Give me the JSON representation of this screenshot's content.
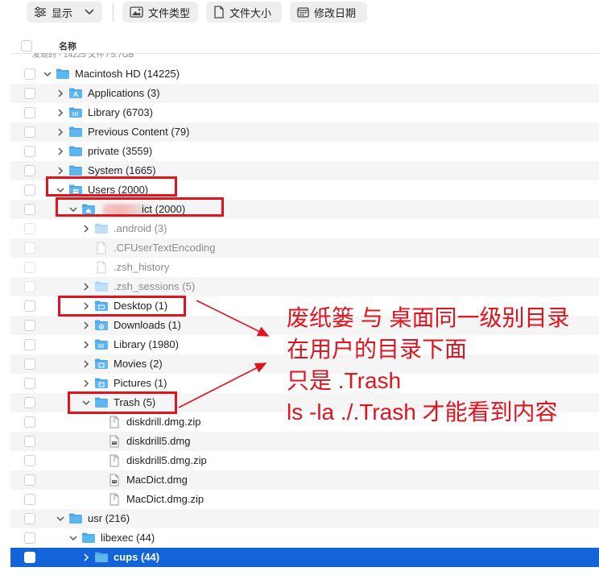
{
  "toolbar": {
    "display_label": "显示",
    "filetype_label": "文件类型",
    "filesize_label": "文件大小",
    "modified_label": "修改日期"
  },
  "header": {
    "name_label": "名称"
  },
  "summary": "发现的 - 14225 文件 / 5.7GB",
  "rows": [
    {
      "name": "Macintosh HD (14225)",
      "indent": 0,
      "chevron": "down",
      "icon": "folder",
      "faded": false,
      "odd": false
    },
    {
      "name": "Applications (3)",
      "indent": 1,
      "chevron": "right",
      "icon": "folder-apps",
      "faded": false,
      "odd": true
    },
    {
      "name": "Library (6703)",
      "indent": 1,
      "chevron": "right",
      "icon": "folder-library",
      "faded": false,
      "odd": false
    },
    {
      "name": "Previous Content (79)",
      "indent": 1,
      "chevron": "right",
      "icon": "folder",
      "faded": false,
      "odd": true
    },
    {
      "name": "private (3559)",
      "indent": 1,
      "chevron": "right",
      "icon": "folder",
      "faded": false,
      "odd": false
    },
    {
      "name": "System (1665)",
      "indent": 1,
      "chevron": "right",
      "icon": "folder",
      "faded": false,
      "odd": true
    },
    {
      "name": "Users (2000)",
      "indent": 1,
      "chevron": "down",
      "icon": "folder-users",
      "faded": false,
      "odd": false
    },
    {
      "name": "ict (2000)",
      "indent": 2,
      "chevron": "down",
      "icon": "folder-home",
      "faded": false,
      "odd": true,
      "blurred": true
    },
    {
      "name": ".android (3)",
      "indent": 3,
      "chevron": "right",
      "icon": "folder",
      "faded": true,
      "odd": false
    },
    {
      "name": ".CFUserTextEncoding",
      "indent": 3,
      "chevron": "",
      "icon": "file",
      "faded": true,
      "odd": true
    },
    {
      "name": ".zsh_history",
      "indent": 3,
      "chevron": "",
      "icon": "file",
      "faded": true,
      "odd": false
    },
    {
      "name": ".zsh_sessions (5)",
      "indent": 3,
      "chevron": "right",
      "icon": "folder",
      "faded": true,
      "odd": true
    },
    {
      "name": "Desktop (1)",
      "indent": 3,
      "chevron": "right",
      "icon": "folder-desktop",
      "faded": false,
      "odd": false
    },
    {
      "name": "Downloads (1)",
      "indent": 3,
      "chevron": "right",
      "icon": "folder-downloads",
      "faded": false,
      "odd": true
    },
    {
      "name": "Library (1980)",
      "indent": 3,
      "chevron": "right",
      "icon": "folder-library",
      "faded": false,
      "odd": false
    },
    {
      "name": "Movies (2)",
      "indent": 3,
      "chevron": "right",
      "icon": "folder-movies",
      "faded": false,
      "odd": true
    },
    {
      "name": "Pictures (1)",
      "indent": 3,
      "chevron": "right",
      "icon": "folder-pictures",
      "faded": false,
      "odd": false
    },
    {
      "name": "Trash (5)",
      "indent": 3,
      "chevron": "down",
      "icon": "folder",
      "faded": false,
      "odd": true
    },
    {
      "name": "diskdrill.dmg.zip",
      "indent": 4,
      "chevron": "",
      "icon": "zip",
      "faded": false,
      "odd": false
    },
    {
      "name": "diskdrill5.dmg",
      "indent": 4,
      "chevron": "",
      "icon": "dmg",
      "faded": false,
      "odd": true
    },
    {
      "name": "diskdrill5.dmg.zip",
      "indent": 4,
      "chevron": "",
      "icon": "zip",
      "faded": false,
      "odd": false
    },
    {
      "name": "MacDict.dmg",
      "indent": 4,
      "chevron": "",
      "icon": "dmg",
      "faded": false,
      "odd": true
    },
    {
      "name": "MacDict.dmg.zip",
      "indent": 4,
      "chevron": "",
      "icon": "zip",
      "faded": false,
      "odd": false
    },
    {
      "name": "usr (216)",
      "indent": 1,
      "chevron": "down",
      "icon": "folder",
      "faded": false,
      "odd": true
    },
    {
      "name": "libexec (44)",
      "indent": 2,
      "chevron": "down",
      "icon": "folder",
      "faded": false,
      "odd": false
    },
    {
      "name": "cups (44)",
      "indent": 3,
      "chevron": "right",
      "icon": "folder",
      "faded": false,
      "odd": false,
      "selected": true
    }
  ],
  "annotation": {
    "line1": "废纸篓 与 桌面同一级别目录",
    "line2": "在用户的目录下面",
    "line3": "只是 .Trash",
    "line4": "ls -la ./.Trash 才能看到内容"
  },
  "colors": {
    "selection": "#1264d8",
    "annotation_red": "#e0141e",
    "folder_blue": "#5fb6ef"
  }
}
